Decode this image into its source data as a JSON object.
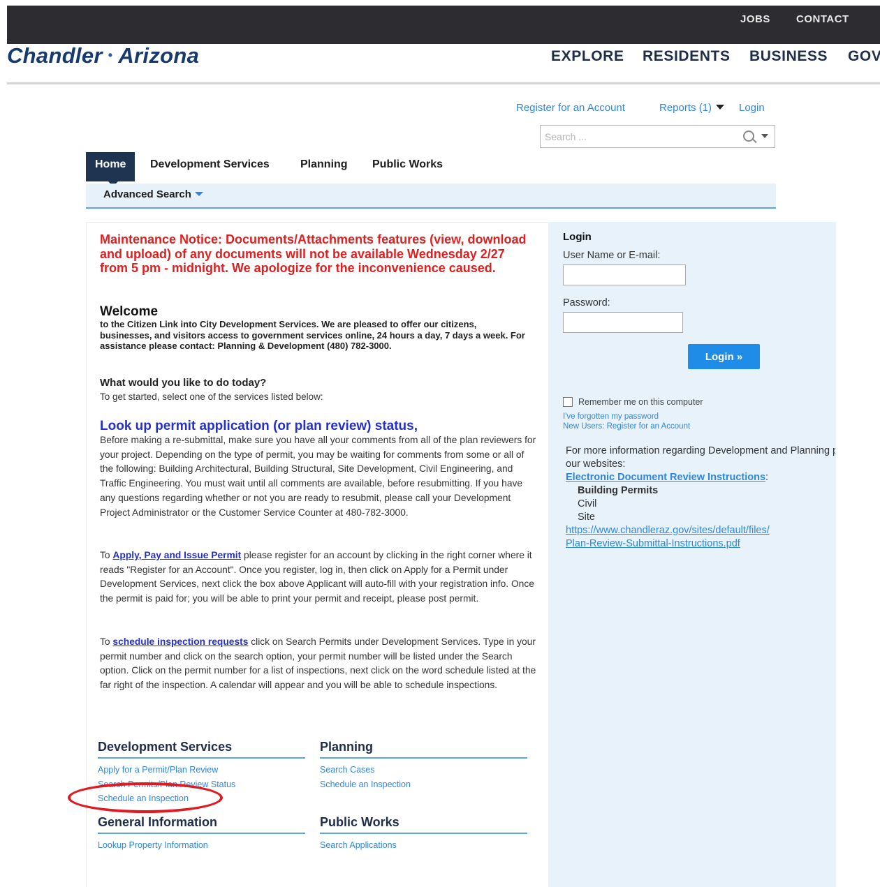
{
  "topbar": {
    "jobs": "JOBS",
    "contact": "CONTACT"
  },
  "logo": {
    "left": "Chandler",
    "separator": "•",
    "right": "Arizona"
  },
  "main_nav": {
    "explore": "EXPLORE",
    "residents": "RESIDENTS",
    "business": "BUSINESS",
    "gov": "GOV"
  },
  "account_links": {
    "register": "Register for an Account",
    "reports": "Reports (1)",
    "login": "Login"
  },
  "search": {
    "placeholder": "Search ..."
  },
  "tabs": {
    "home": "Home",
    "development_services": "Development Services",
    "planning": "Planning",
    "public_works": "Public Works"
  },
  "advanced_search": "Advanced Search",
  "notice": "Maintenance Notice: Documents/Attachments features (view, download and upload) of any documents will not be available Wednesday 2/27 from 5 pm - midnight. We apologize for the inconvenience caused.",
  "welcome": {
    "heading": "Welcome",
    "text": "to the Citizen Link into City Development Services. We are pleased to offer our citizens, businesses, and visitors access to government services online, 24 hours a day, 7 days a week. For assistance please contact: Planning & Development (480) 782-3000."
  },
  "question": {
    "heading": "What would you like to do today?",
    "text": "To get started, select one of the services listed below:"
  },
  "lookup": {
    "heading": "Look up permit application (or plan review) status,",
    "text": "Before making a re-submittal, make sure you have all your comments from all of the plan reviewers for your project. Depending on the type of permit, you may be waiting for comments from some or all of the following: Building Architectural, Building Structural, Site Development, Civil Engineering, and Traffic Engineering. You must wait until all comments are available, before resubmitting. If you have any questions regarding whether or not you are ready to resubmit, please call your Development Project Administrator or the Customer Service Counter at 480-782-3000."
  },
  "apply": {
    "prefix": "To",
    "link": "Apply, Pay and Issue Permit",
    "text": "please register for an account by clicking in the right corner where it reads \"Register for an Account\". Once you register, log in, then click on Apply for a Permit under Development Services, next click the box above Applicant will auto-fill with your registration info. Once the permit is paid for; you will be able to print your permit and receipt, please post permit."
  },
  "schedule": {
    "prefix": "To",
    "link": "schedule inspection requests",
    "text": "click on Search Permits under Development Services. Type in your permit number and click on the search option, your permit number will be listed under the Search option. Click on the permit number for a list of inspections, next click on the word schedule listed at the far right of the inspection. A calendar will appear and you will be able to schedule inspections."
  },
  "sections": {
    "development_services": {
      "heading": "Development Services",
      "links": [
        "Apply for a Permit/Plan Review",
        "Search Permits/Plan Review Status",
        "Schedule an Inspection"
      ]
    },
    "planning": {
      "heading": "Planning",
      "links": [
        "Search Cases",
        "Schedule an Inspection"
      ]
    },
    "general_information": {
      "heading": "General Information",
      "links": [
        "Lookup Property Information"
      ]
    },
    "public_works": {
      "heading": "Public Works",
      "links": [
        "Search Applications"
      ]
    }
  },
  "login_panel": {
    "heading": "Login",
    "user_label": "User Name or E-mail:",
    "password_label": "Password:",
    "button": "Login »",
    "remember": "Remember me on this computer",
    "forgot": "I've forgotten my password",
    "new_users": "New Users: Register for an Account",
    "info_line1": "For more information regarding Development and Planning please visit",
    "info_line2": "our websites:",
    "eri_link": "Electronic Document Review Instructions",
    "eri_colon": ":",
    "items": [
      "Building Permits",
      "Civil",
      "Site"
    ],
    "url_line1": "https://www.chandleraz.gov/sites/default/files/",
    "url_line2": "Plan-Review-Submittal-Instructions.pdf"
  },
  "colors": {
    "notice_red": "#e02020",
    "link_blue": "#2e86de",
    "nav_dark": "#1f3450",
    "panel_blue": "#e7f2fb",
    "highlight_red": "#e11a22"
  }
}
